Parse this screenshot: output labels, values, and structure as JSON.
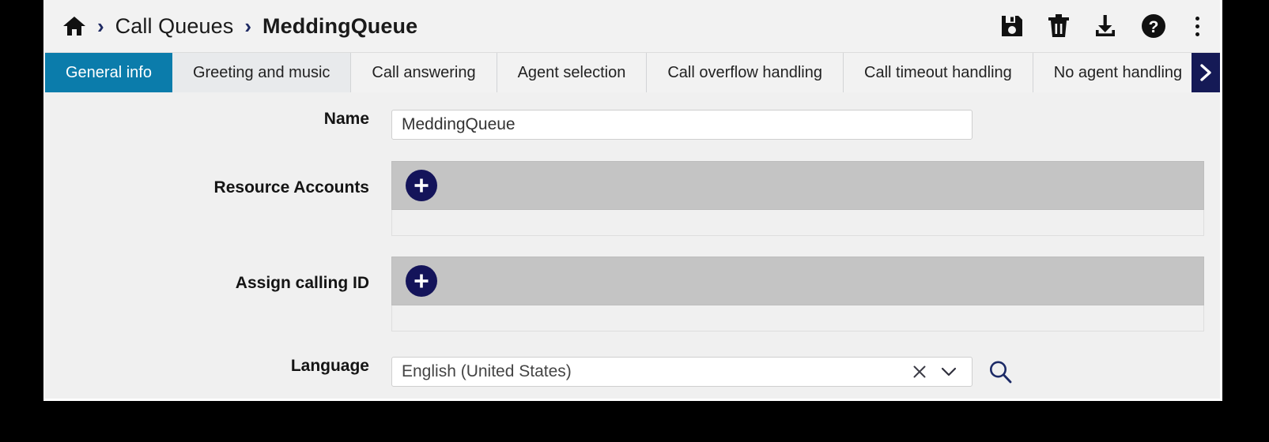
{
  "window": {
    "breadcrumb": {
      "home_icon": "home-icon",
      "separator": "›",
      "items": [
        {
          "label": "Call Queues",
          "bold": false
        },
        {
          "label": "MeddingQueue",
          "bold": true
        }
      ]
    },
    "header_actions": [
      {
        "name": "save-button",
        "icon": "save-floppy-icon",
        "title": "Save"
      },
      {
        "name": "delete-button",
        "icon": "trash-icon",
        "title": "Delete"
      },
      {
        "name": "download-button",
        "icon": "download-icon",
        "title": "Download"
      },
      {
        "name": "help-button",
        "icon": "help-circle-icon",
        "title": "Help"
      },
      {
        "name": "more-options-button",
        "icon": "kebab-menu-icon",
        "title": "More options"
      }
    ]
  },
  "tabs": {
    "items": [
      {
        "label": "General info",
        "active": true
      },
      {
        "label": "Greeting and music",
        "active": false
      },
      {
        "label": "Call answering",
        "active": false
      },
      {
        "label": "Agent selection",
        "active": false
      },
      {
        "label": "Call overflow handling",
        "active": false
      },
      {
        "label": "Call timeout handling",
        "active": false
      },
      {
        "label": "No agent handling",
        "active": false
      }
    ],
    "scroll_next_icon": "chevron-right-icon"
  },
  "form": {
    "name": {
      "label": "Name",
      "value": "MeddingQueue",
      "placeholder": ""
    },
    "resource_accounts": {
      "label": "Resource Accounts",
      "add_icon": "plus-icon",
      "items": []
    },
    "assign_calling_id": {
      "label": "Assign calling ID",
      "add_icon": "plus-icon",
      "items": []
    },
    "language": {
      "label": "Language",
      "value": "English (United States)",
      "clear_icon": "close-x-icon",
      "dropdown_icon": "chevron-down-icon",
      "search_icon": "search-icon"
    }
  },
  "colors": {
    "tab_active": "#0b7cab",
    "accent_navy": "#14145a",
    "scroll_button": "#151a56",
    "picker_toolbar": "#c4c4c4",
    "page_bg": "#f0f0f0"
  }
}
